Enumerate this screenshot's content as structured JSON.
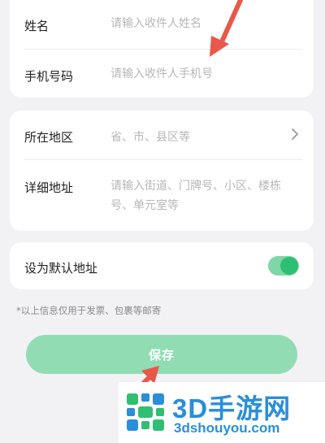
{
  "contact": {
    "name_label": "姓名",
    "name_placeholder": "请输入收件人姓名",
    "phone_label": "手机号码",
    "phone_placeholder": "请输入收件人手机号"
  },
  "address": {
    "region_label": "所在地区",
    "region_placeholder": "省、市、县区等",
    "detail_label": "详细地址",
    "detail_placeholder": "请输入街道、门牌号、小区、楼栋号、单元室等"
  },
  "default_address": {
    "label": "设为默认地址",
    "enabled": true
  },
  "note": "*以上信息仅用于发票、包裹等邮寄",
  "save_label": "保存",
  "watermark": {
    "title": "3D手游网",
    "url": "3dshouyou.com"
  },
  "colors": {
    "accent": "#2fbf73",
    "button": "#92dcb4",
    "annotation_arrow": "#e8584a",
    "watermark": "#2a8fd8"
  }
}
